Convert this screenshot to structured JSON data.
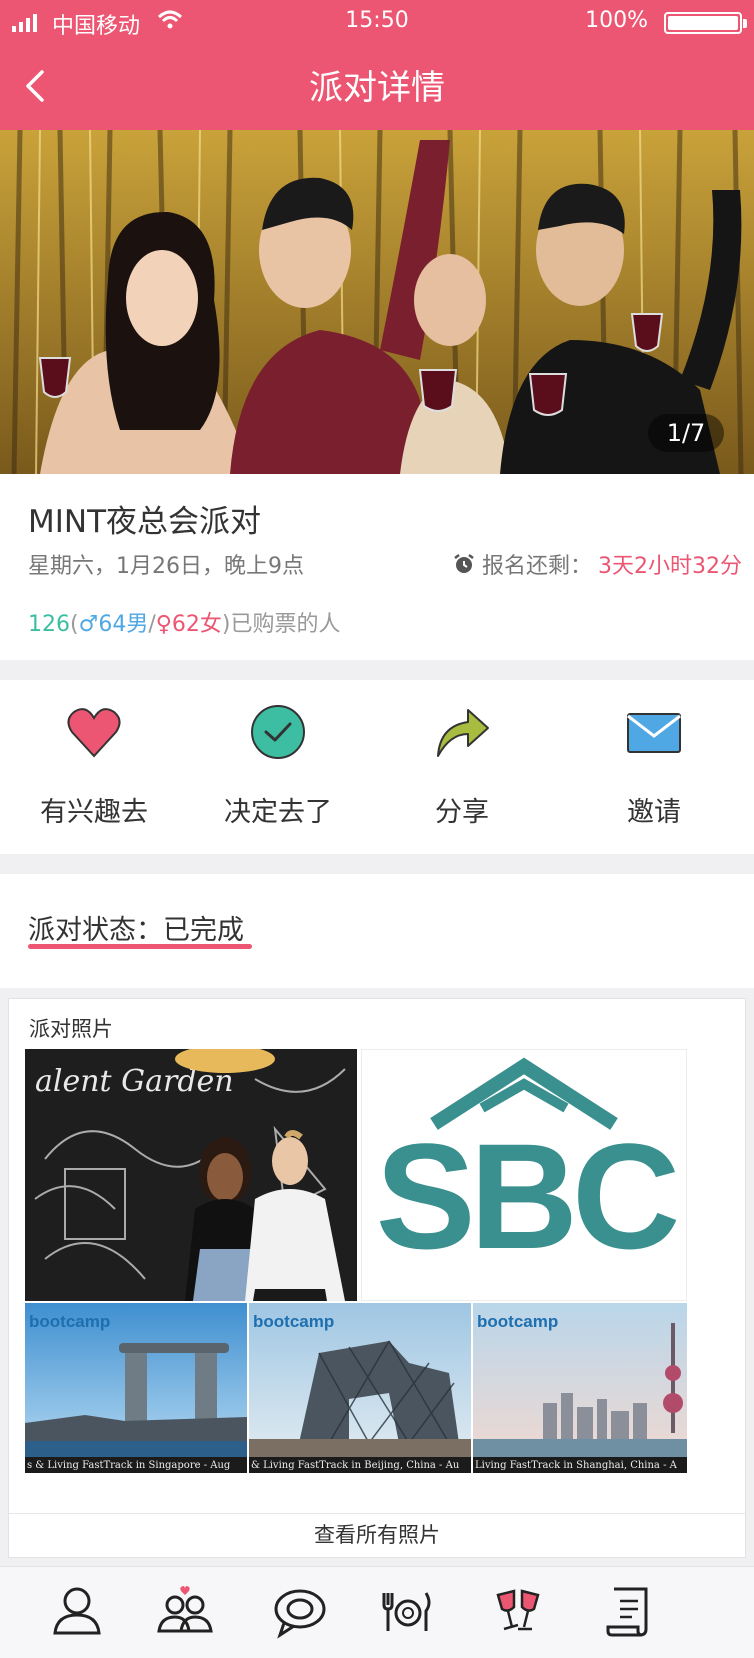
{
  "status_bar": {
    "carrier": "中国移动",
    "time": "15:50",
    "battery": "100%"
  },
  "nav": {
    "title": "派对详情"
  },
  "hero": {
    "counter": "1/7"
  },
  "party": {
    "name": "MINT夜总会派对",
    "datetime": "星期六，1月26日，晚上9点",
    "deadline_label": "报名还剩：",
    "deadline_value": "3天2小时32分",
    "total": "126",
    "open_paren": "(",
    "male_symbol": "♂",
    "male_count": "64男",
    "slash": "/",
    "female_symbol": "♀",
    "female_count": "62女",
    "close_suffix": ")已购票的人"
  },
  "actions": [
    {
      "label": "有兴趣去",
      "icon": "heart-icon"
    },
    {
      "label": "决定去了",
      "icon": "check-circle-icon"
    },
    {
      "label": "分享",
      "icon": "share-arrow-icon"
    },
    {
      "label": "邀请",
      "icon": "envelope-icon"
    }
  ],
  "status": {
    "text": "派对状态：已完成"
  },
  "photos": {
    "heading": "派对照片",
    "view_all": "查看所有照片",
    "sbc_logo_text": "SBC",
    "chalk_text": "alent Garden",
    "banner_brand": "bootcamp",
    "captions": [
      "s & Living FastTrack in Singapore - Aug",
      "& Living FastTrack in Beijing, China - Au",
      "Living FastTrack in Shanghai, China - A"
    ]
  },
  "tabbar": {
    "tabs": [
      "profile-icon",
      "matchmaking-icon",
      "chat-icon",
      "dining-icon",
      "party-toast-icon",
      "scroll-icon"
    ]
  },
  "colors": {
    "accent": "#ec5673",
    "teal": "#3dbea2",
    "blue": "#4fa8e3",
    "sbc_teal": "#3a8f8f",
    "share_green": "#a8bd40"
  }
}
